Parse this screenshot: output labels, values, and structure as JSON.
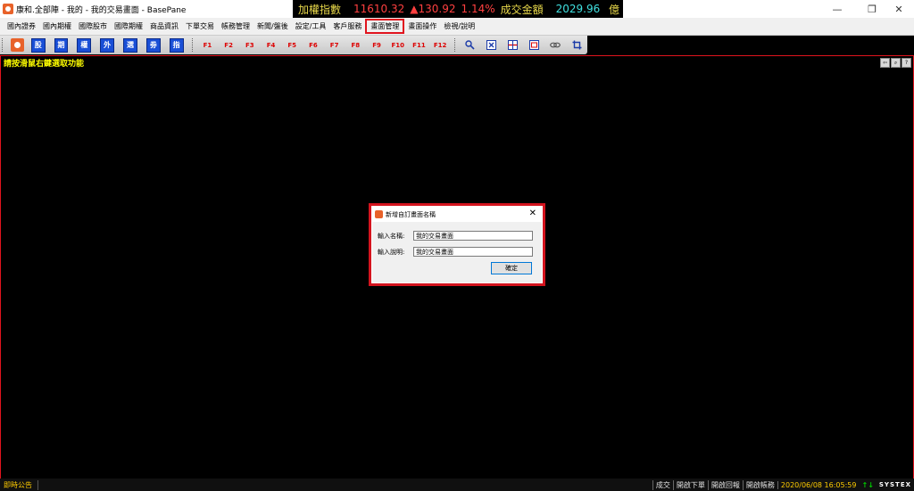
{
  "window": {
    "title": "康和.全部陣 - 我的 - 我的交易畫面 - BasePane",
    "minimize": "—",
    "restore": "❐",
    "close": "✕"
  },
  "ticker": {
    "label": "加權指數",
    "index": "11610.32",
    "change": "▲130.92",
    "percent": "1.14%",
    "volume_label": "成交金額",
    "volume": "2029.96",
    "unit": "億",
    "colors": {
      "label": "#e8d84a",
      "index": "#ff4040",
      "up": "#ff4040",
      "volume": "#40e0e0"
    }
  },
  "menu": {
    "items": [
      "國內證券",
      "國內期權",
      "國際股市",
      "國際期權",
      "商品資訊",
      "下單交易",
      "帳務管理",
      "新聞/盤後",
      "設定/工具",
      "客戶服務",
      "畫面管理",
      "畫面操作",
      "檢視/說明"
    ],
    "active_index": 10
  },
  "toolbar": {
    "blue_buttons": [
      "股",
      "期",
      "權",
      "外",
      "選",
      "劵",
      "指"
    ],
    "function_keys": [
      "F1",
      "F2",
      "F3",
      "F4",
      "F5",
      "F6",
      "F7",
      "F8",
      "F9",
      "F10",
      "F11",
      "F12"
    ],
    "tool_icons": [
      "magnifier-icon",
      "close-box-icon",
      "split-icon",
      "window-icon",
      "link-icon",
      "crop-icon"
    ]
  },
  "main": {
    "hint": "請按滑鼠右鍵選取功能",
    "corner_buttons": [
      "⇦",
      "⌕",
      "?"
    ]
  },
  "dialog": {
    "title": "新增自訂畫面名稱",
    "close": "✕",
    "name_label": "輸入名稱:",
    "name_value": "我的交易畫面",
    "desc_label": "輸入說明:",
    "desc_value": "我的交易畫面",
    "ok_label": "確定"
  },
  "status": {
    "announcement": "即時公告",
    "items": [
      "成交",
      "開啟下單",
      "開啟回報",
      "開啟帳務"
    ],
    "datetime": "2020/06/08 16:05:59",
    "signal": "↑↓",
    "brand": "SYSTEX"
  }
}
